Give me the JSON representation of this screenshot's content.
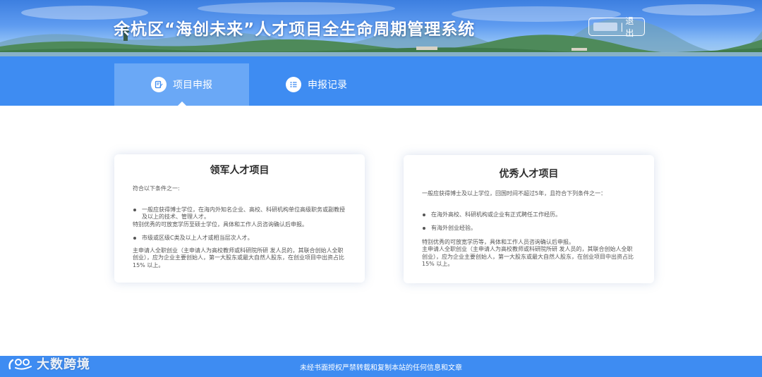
{
  "header": {
    "title": "余杭区“海创未来”人才项目全生命周期管理系统",
    "user_separator": "|",
    "logout_label": "退出"
  },
  "nav": {
    "tabs": [
      {
        "label": "项目申报",
        "icon": "edit-document-icon",
        "active": true
      },
      {
        "label": "申报记录",
        "icon": "list-icon",
        "active": false
      }
    ]
  },
  "cards": [
    {
      "title": "领军人才项目",
      "intro": "符合以下条件之一:",
      "bullet1": "一般应获得博士学位，在海内外知名企业、高校、科研机构单位高级职务或副教授及以上的技术、管理人才。",
      "note1": "特别优秀的可放宽学历至硕士学位，具体和工作人员咨询确认后申报。",
      "bullet2": "市级或区级C类及以上人才或相当层次人才。",
      "note2": "主申请人全职创业（主申请人为高校教师或科研院所研 发人员的，其联合创始人全职创业），应为企业主要创始人，第一大股东或最大自然人股东，在创业项目中出资占比15% 以上。"
    },
    {
      "title": "优秀人才项目",
      "intro": "一般应获得博士及以上学位，回国时间不超过5年，且符合下列条件之一：",
      "bullet1": "在海外高校、科研机构或企业有正式聘任工作经历。",
      "bullet2": "有海外创业经验。",
      "note1": "特别优秀的可放宽学历等，具体和工作人员咨询确认后申报。",
      "note2": "主申请人全职创业（主申请人为高校教师或科研院所研 发人员的，其联合创始人全职创业），应为企业主要创始人，第一大股东或最大自然人股东，在创业项目中出资占比15% 以上。"
    }
  ],
  "footer": {
    "text": "未经书面授权严禁转载和复制本站的任何信息和文章"
  },
  "watermark": {
    "text": "大数跨境"
  },
  "colors": {
    "primary": "#3e8cf2",
    "active_tab": "#6aa8f6",
    "title_text": "#2a2a2a",
    "body_text": "#555555"
  }
}
